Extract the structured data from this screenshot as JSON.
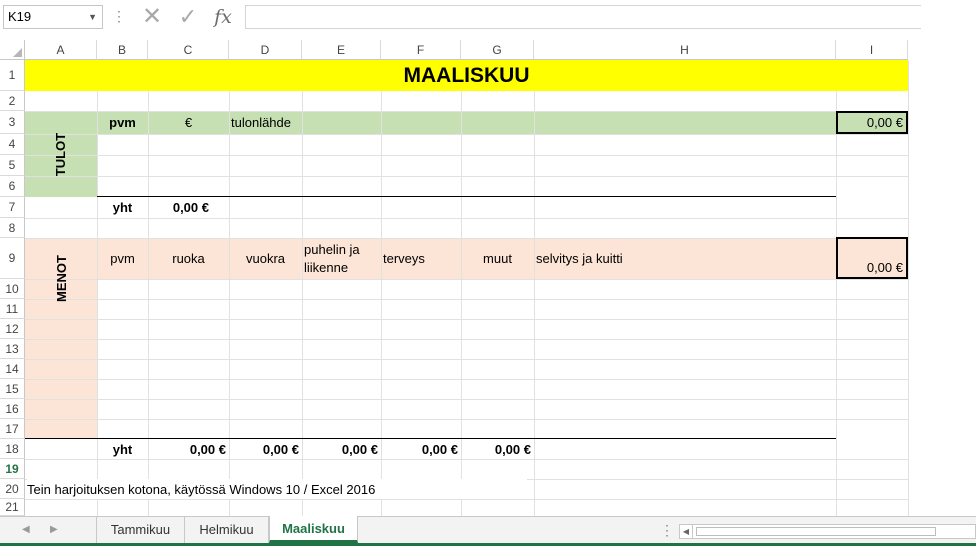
{
  "formula_bar": {
    "name_box": "K19",
    "fx_label": "fx",
    "formula": ""
  },
  "columns": [
    "A",
    "B",
    "C",
    "D",
    "E",
    "F",
    "G",
    "H",
    "I"
  ],
  "rows": [
    "1",
    "2",
    "3",
    "4",
    "5",
    "6",
    "7",
    "8",
    "9",
    "10",
    "11",
    "12",
    "13",
    "14",
    "15",
    "16",
    "17",
    "18",
    "19",
    "20",
    "21"
  ],
  "sheet": {
    "title": "MAALISKUU",
    "tulot": {
      "label": "TULOT",
      "header_pvm": "pvm",
      "header_eur": "€",
      "header_source": "tulonlähde",
      "total_label": "yht",
      "total_value": "0,00 €",
      "box_value": "0,00 €"
    },
    "menot": {
      "label": "MENOT",
      "headers": {
        "pvm": "pvm",
        "ruoka": "ruoka",
        "vuokra": "vuokra",
        "puhelin": "puhelin ja liikenne",
        "terveys": "terveys",
        "muut": "muut",
        "selvitys": "selvitys ja kuitti"
      },
      "box_value": "0,00 €",
      "total_label": "yht",
      "totals": [
        "0,00 €",
        "0,00 €",
        "0,00 €",
        "0,00 €",
        "0,00 €"
      ]
    },
    "note": "Tein harjoituksen kotona, käytössä Windows 10 / Excel 2016"
  },
  "tabs": {
    "items": [
      "Tammikuu",
      "Helmikuu",
      "Maaliskuu"
    ],
    "active": "Maaliskuu"
  },
  "colors": {
    "title_fill": "#ffff00",
    "tulot_fill": "#c6e0b4",
    "menot_fill": "#fce4d6",
    "accent": "#217346"
  }
}
